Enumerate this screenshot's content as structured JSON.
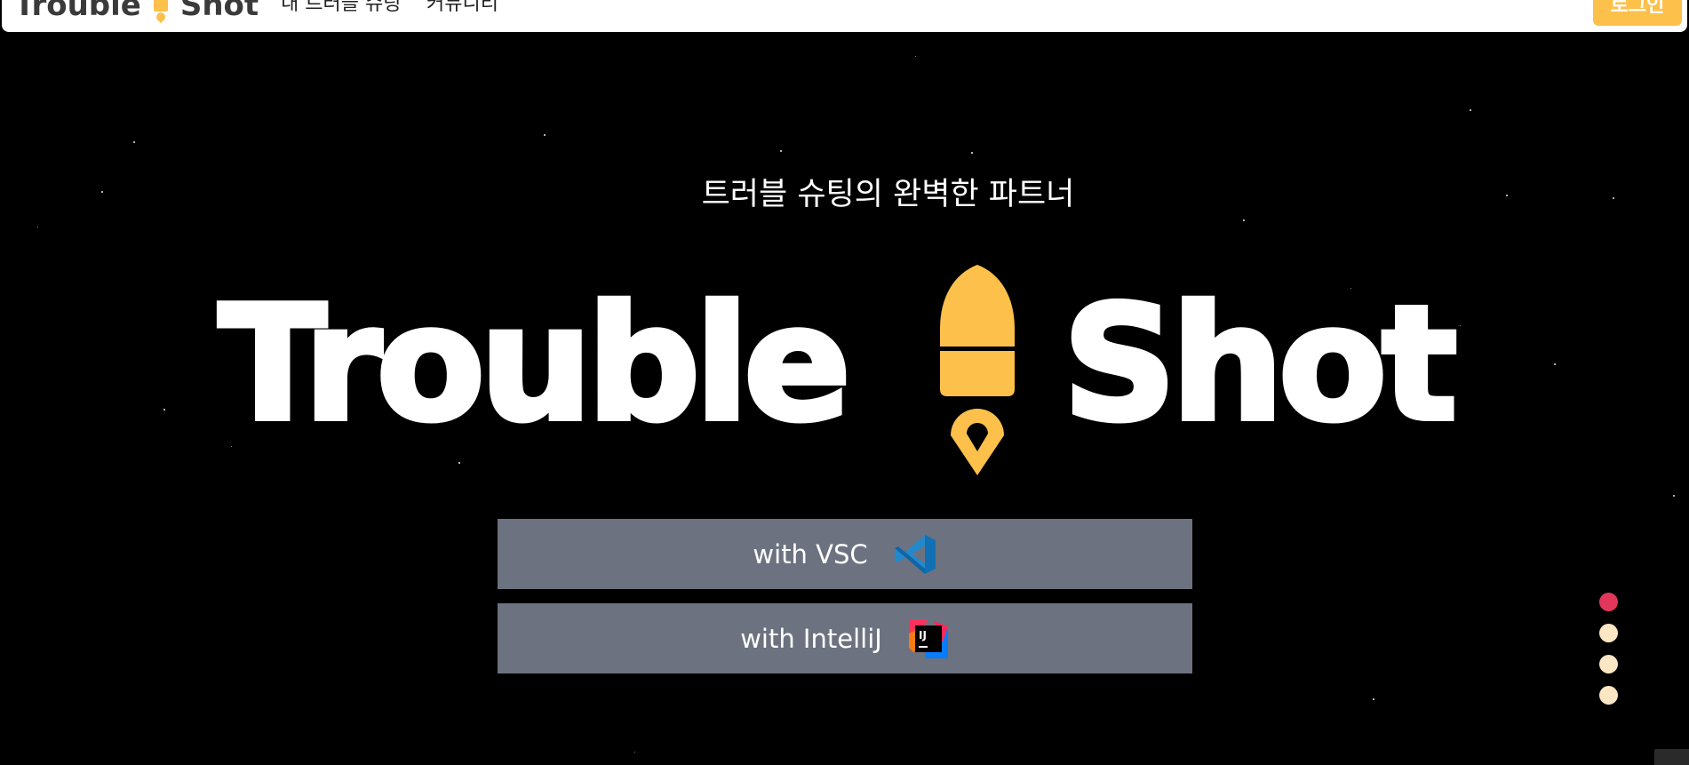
{
  "header": {
    "logo_left": "Trouble",
    "logo_right": "Shot",
    "nav": [
      "내 트러블 슈팅",
      "커뮤니티"
    ],
    "login_label": "로그인"
  },
  "hero": {
    "tagline": "트러블 슈팅의 완벽한 파트너",
    "logo_left": "Trouble",
    "logo_right": "Shot"
  },
  "buttons": {
    "vsc_label": "with VSC",
    "vsc_icon": "vscode-icon",
    "intellij_label": "with IntelliJ",
    "intellij_icon": "intellij-icon"
  },
  "pagination": {
    "count": 4,
    "active_index": 0
  },
  "colors": {
    "accent": "#fcc04b",
    "background": "#000000",
    "button_bg": "#6d7280",
    "dot_active": "#e2365b",
    "dot_inactive": "#fde6c4"
  }
}
